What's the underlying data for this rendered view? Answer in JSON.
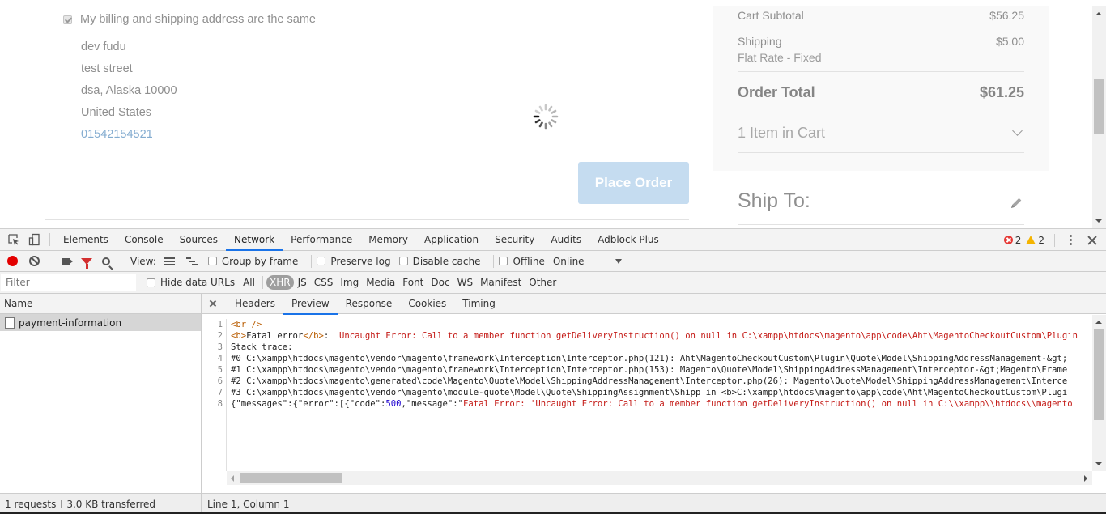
{
  "checkout": {
    "billing_same_label": "My billing and shipping address are the same",
    "address": {
      "name": "dev fudu",
      "street": "test street",
      "city_region_zip": "dsa, Alaska 10000",
      "country": "United States",
      "phone": "01542154521"
    },
    "place_order_label": "Place Order",
    "summary": {
      "subtotal_label": "Cart Subtotal",
      "subtotal_value": "$56.25",
      "shipping_label": "Shipping",
      "shipping_value": "$5.00",
      "shipping_method": "Flat Rate - Fixed",
      "total_label": "Order Total",
      "total_value": "$61.25",
      "items_label": "1 Item in Cart"
    },
    "ship_to_label": "Ship To:"
  },
  "devtools": {
    "tabs": [
      "Elements",
      "Console",
      "Sources",
      "Network",
      "Performance",
      "Memory",
      "Application",
      "Security",
      "Audits",
      "Adblock Plus"
    ],
    "active_tab": "Network",
    "error_count": "2",
    "warning_count": "2",
    "toolbar": {
      "view_label": "View:",
      "group_by_frame": "Group by frame",
      "preserve_log": "Preserve log",
      "disable_cache": "Disable cache",
      "offline": "Offline",
      "throttle": "Online"
    },
    "filter": {
      "placeholder": "Filter",
      "hide_data_urls": "Hide data URLs",
      "types": [
        "All",
        "XHR",
        "JS",
        "CSS",
        "Img",
        "Media",
        "Font",
        "Doc",
        "WS",
        "Manifest",
        "Other"
      ],
      "active_type": "XHR"
    },
    "requests": {
      "header": "Name",
      "items": [
        "payment-information"
      ]
    },
    "detail_tabs": [
      "Headers",
      "Preview",
      "Response",
      "Cookies",
      "Timing"
    ],
    "active_detail_tab": "Preview",
    "code_lines": [
      "<br />",
      "<b>Fatal error</b>:  Uncaught Error: Call to a member function getDeliveryInstruction() on null in C:\\xampp\\htdocs\\magento\\app\\code\\Aht\\MagentoCheckoutCustom\\Plugin",
      "Stack trace:",
      "#0 C:\\xampp\\htdocs\\magento\\vendor\\magento\\framework\\Interception\\Interceptor.php(121): Aht\\MagentoCheckoutCustom\\Plugin\\Quote\\Model\\ShippingAddressManagement-&gt;",
      "#1 C:\\xampp\\htdocs\\magento\\vendor\\magento\\framework\\Interception\\Interceptor.php(153): Magento\\Quote\\Model\\ShippingAddressManagement\\Interceptor-&gt;Magento\\Frame",
      "#2 C:\\xampp\\htdocs\\magento\\generated\\code\\Magento\\Quote\\Model\\ShippingAddressManagement\\Interceptor.php(26): Magento\\Quote\\Model\\ShippingAddressManagement\\Interce",
      "#3 C:\\xampp\\htdocs\\magento\\vendor\\magento\\module-quote\\Model\\Quote\\ShippingAssignment\\Shipp in <b>C:\\xampp\\htdocs\\magento\\app\\code\\Aht\\MagentoCheckoutCustom\\Plugi",
      "{\"messages\":{\"error\":[{\"code\":500,\"message\":\"Fatal Error: 'Uncaught Error: Call to a member function getDeliveryInstruction() on null in C:\\\\xampp\\\\htdocs\\\\magento"
    ],
    "status": {
      "requests": "1 requests",
      "transferred": "3.0 KB transferred",
      "cursor": "Line 1, Column 1"
    }
  }
}
